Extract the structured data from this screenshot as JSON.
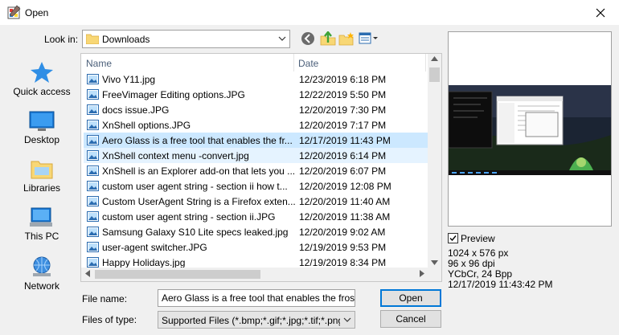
{
  "window": {
    "title": "Open"
  },
  "look_in": {
    "label": "Look in:",
    "value": "Downloads"
  },
  "toolbar": {
    "back_icon": "back-arrow-icon",
    "up_icon": "up-folder-icon",
    "new_folder_icon": "new-folder-icon",
    "views_icon": "views-menu-icon"
  },
  "places": [
    {
      "label": "Quick access",
      "icon": "quick-access-star-icon"
    },
    {
      "label": "Desktop",
      "icon": "desktop-icon"
    },
    {
      "label": "Libraries",
      "icon": "libraries-icon"
    },
    {
      "label": "This PC",
      "icon": "this-pc-icon"
    },
    {
      "label": "Network",
      "icon": "network-icon"
    }
  ],
  "file_list": {
    "columns": [
      "Name",
      "Date"
    ],
    "rows": [
      {
        "name": "Vivo Y11.jpg",
        "date": "12/23/2019 6:18 PM"
      },
      {
        "name": "FreeVimager Editing options.JPG",
        "date": "12/22/2019 5:50 PM"
      },
      {
        "name": "docs issue.JPG",
        "date": "12/20/2019 7:30 PM"
      },
      {
        "name": "XnShell options.JPG",
        "date": "12/20/2019 7:17 PM"
      },
      {
        "name": "Aero Glass is a free tool that enables the fr...",
        "date": "12/17/2019 11:43 PM"
      },
      {
        "name": "XnShell context menu -convert.jpg",
        "date": "12/20/2019 6:14 PM"
      },
      {
        "name": "XnShell is an Explorer add-on that lets you ...",
        "date": "12/20/2019 6:07 PM"
      },
      {
        "name": "custom user agent string - section ii how t...",
        "date": "12/20/2019 12:08 PM"
      },
      {
        "name": "Custom UserAgent String is a Firefox exten...",
        "date": "12/20/2019 11:40 AM"
      },
      {
        "name": "custom user agent string - section ii.JPG",
        "date": "12/20/2019 11:38 AM"
      },
      {
        "name": "Samsung Galaxy S10 Lite specs leaked.jpg",
        "date": "12/20/2019 9:02 AM"
      },
      {
        "name": "user-agent switcher.JPG",
        "date": "12/19/2019 9:53 PM"
      },
      {
        "name": "Happy Holidays.jpg",
        "date": "12/19/2019 8:34 PM"
      }
    ],
    "selected_index": 4,
    "hover_index": 5
  },
  "file_name": {
    "label": "File name:",
    "value": "Aero Glass is a free tool that enables the frosted"
  },
  "file_type": {
    "label": "Files of type:",
    "value": "Supported Files (*.bmp;*.gif;*.jpg;*.tif;*.png;*.pcx"
  },
  "buttons": {
    "open": "Open",
    "cancel": "Cancel"
  },
  "preview": {
    "checkbox_label": "Preview",
    "checked": true,
    "size": "1024 x 576 px",
    "dpi": "96 x 96 dpi",
    "color": "YCbCr, 24 Bpp",
    "timestamp": "12/17/2019 11:43:42 PM"
  },
  "colors": {
    "selected_row": "#cce8ff",
    "hover_row": "#e5f3ff",
    "default_button_border": "#0078d7",
    "folder_yellow": "#f8d775"
  }
}
